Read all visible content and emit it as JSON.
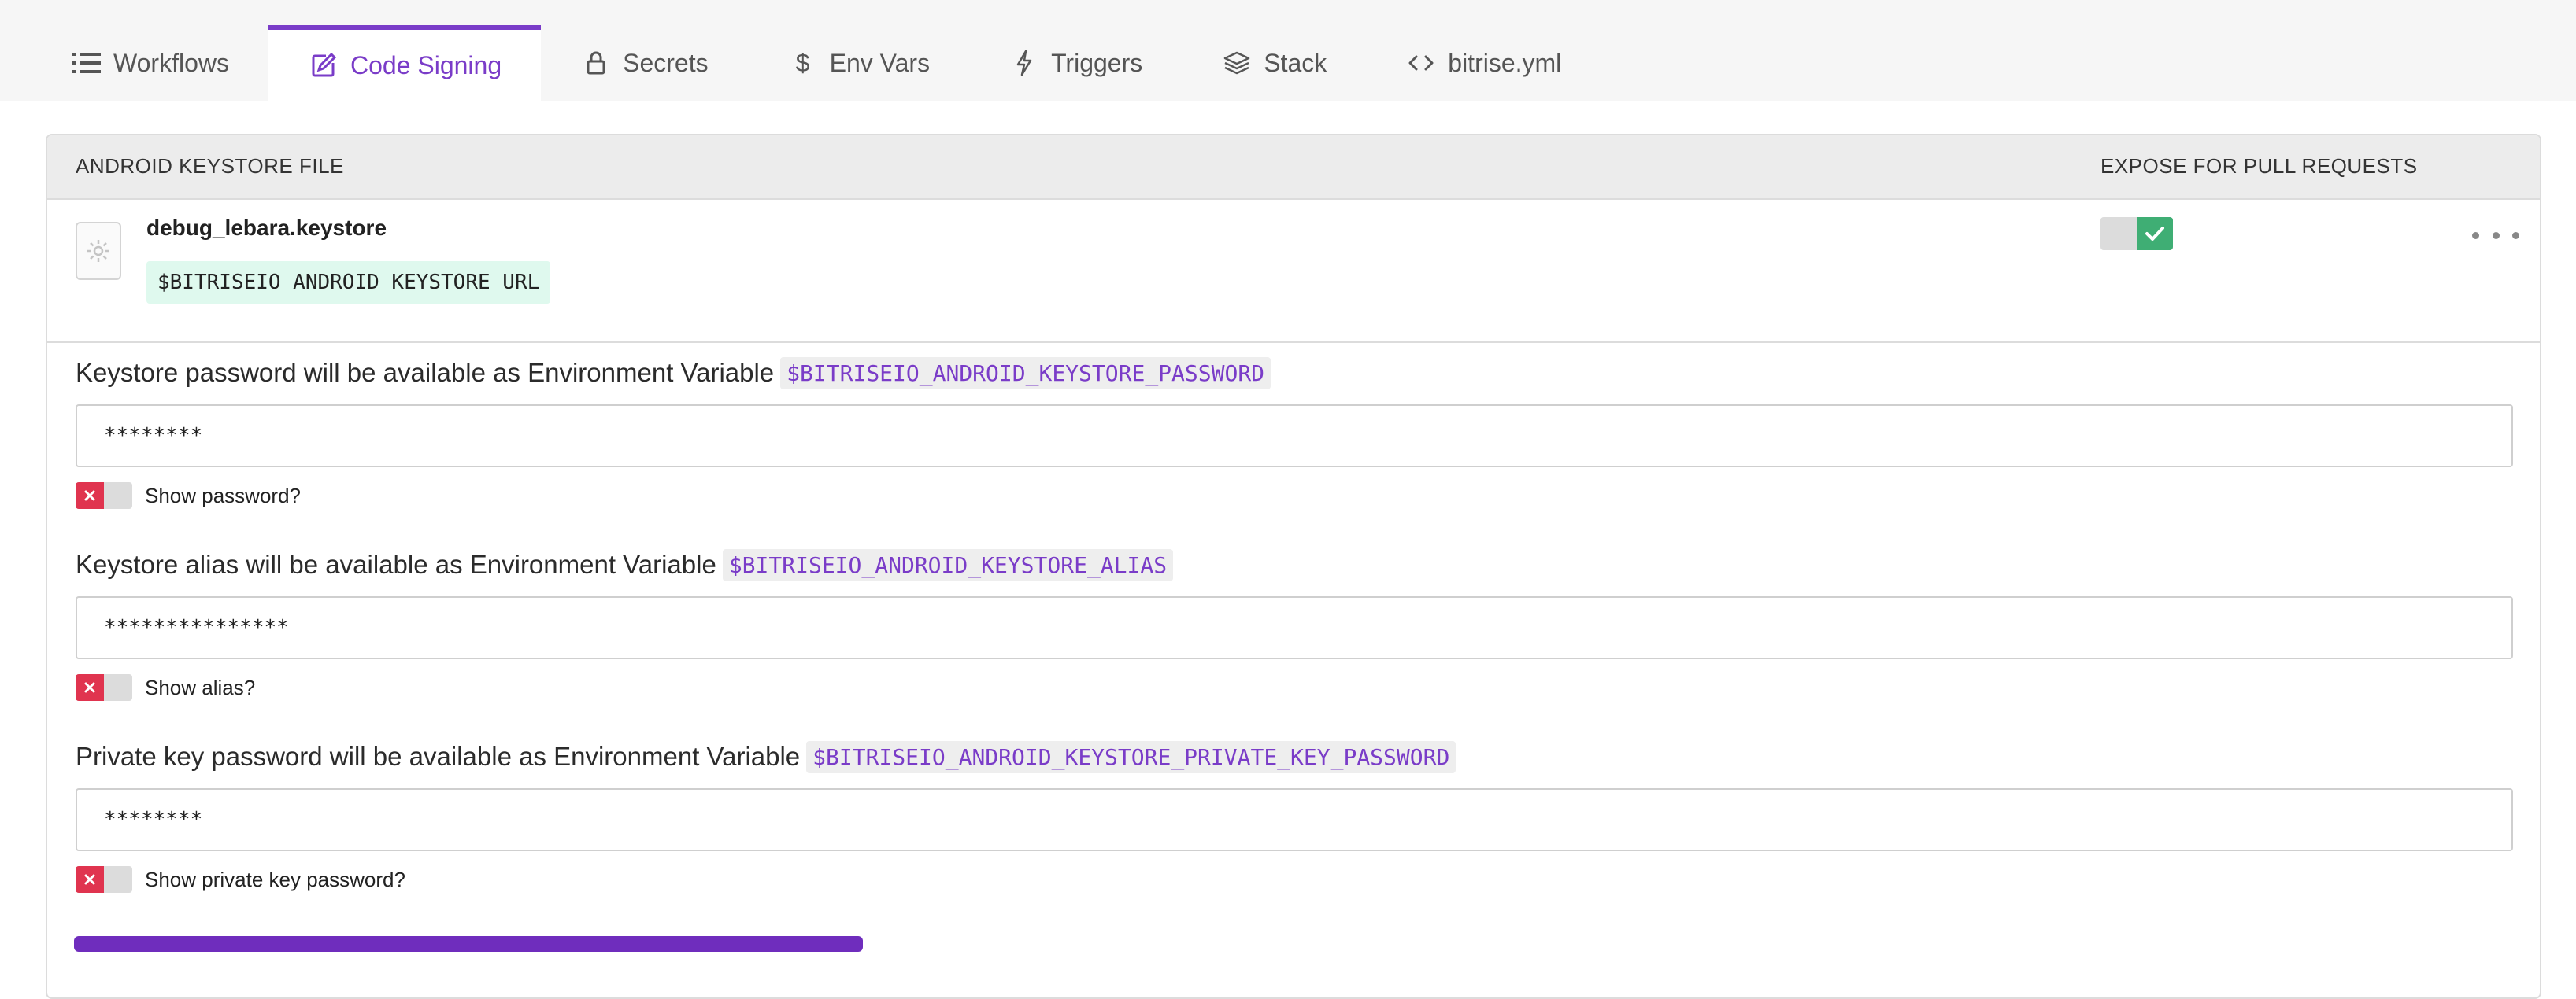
{
  "tabs": [
    {
      "label": "Workflows",
      "icon": "list-icon"
    },
    {
      "label": "Code Signing",
      "icon": "edit-icon",
      "active": true
    },
    {
      "label": "Secrets",
      "icon": "lock-icon"
    },
    {
      "label": "Env Vars",
      "icon": "dollar-icon"
    },
    {
      "label": "Triggers",
      "icon": "bolt-icon"
    },
    {
      "label": "Stack",
      "icon": "layers-icon"
    },
    {
      "label": "bitrise.yml",
      "icon": "code-icon"
    }
  ],
  "accent_color": "#7a3cc8",
  "panel": {
    "header_left": "ANDROID KEYSTORE FILE",
    "header_right": "EXPOSE FOR PULL REQUESTS",
    "file_name": "debug_lebara.keystore",
    "file_url_var": "$BITRISEIO_ANDROID_KEYSTORE_URL",
    "expose_enabled": true
  },
  "fields": [
    {
      "label": "Keystore password will be available as Environment Variable",
      "var": "$BITRISEIO_ANDROID_KEYSTORE_PASSWORD",
      "value": "********",
      "toggle_label": "Show password?"
    },
    {
      "label": "Keystore alias will be available as Environment Variable",
      "var": "$BITRISEIO_ANDROID_KEYSTORE_ALIAS",
      "value": "***************",
      "toggle_label": "Show alias?"
    },
    {
      "label": "Private key password will be available as Environment Variable",
      "var": "$BITRISEIO_ANDROID_KEYSTORE_PRIVATE_KEY_PASSWORD",
      "value": "********",
      "toggle_label": "Show private key password?"
    }
  ]
}
